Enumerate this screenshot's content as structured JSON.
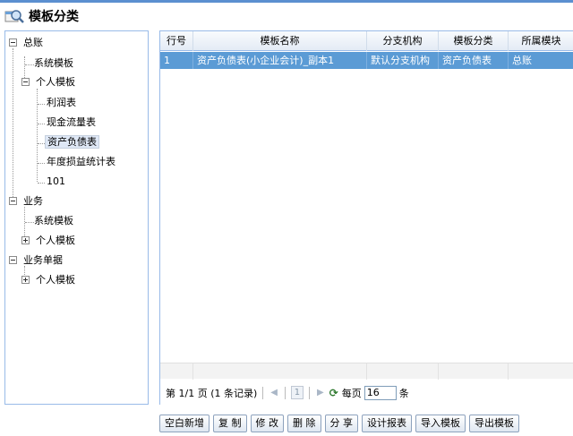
{
  "title": "模板分类",
  "tree": {
    "nodes": [
      {
        "label": "总账"
      },
      {
        "label": "系统模板"
      },
      {
        "label": "个人模板"
      },
      {
        "label": "利润表"
      },
      {
        "label": "现金流量表"
      },
      {
        "label": "资产负债表"
      },
      {
        "label": "年度损益统计表"
      },
      {
        "label": "101"
      },
      {
        "label": "业务"
      },
      {
        "label": "系统模板"
      },
      {
        "label": "个人模板"
      },
      {
        "label": "业务单据"
      },
      {
        "label": "个人模板"
      }
    ]
  },
  "grid": {
    "columns": [
      "行号",
      "模板名称",
      "分支机构",
      "模板分类",
      "所属模块"
    ],
    "rows": [
      {
        "row_no": "1",
        "name": "资产负债表(小企业会计)_副本1",
        "branch": "默认分支机构",
        "category": "资产负债表",
        "module": "总账"
      }
    ]
  },
  "pager": {
    "info": "第 1/1 页 (1 条记录)",
    "current_page": "1",
    "per_page_label": "每页",
    "per_page_value": "16",
    "unit": "条"
  },
  "buttons": {
    "new_blank": "空白新增",
    "copy": "复 制",
    "edit": "修 改",
    "delete": "删 除",
    "share": "分 享",
    "design": "设计报表",
    "import": "导入模板",
    "export": "导出模板"
  }
}
